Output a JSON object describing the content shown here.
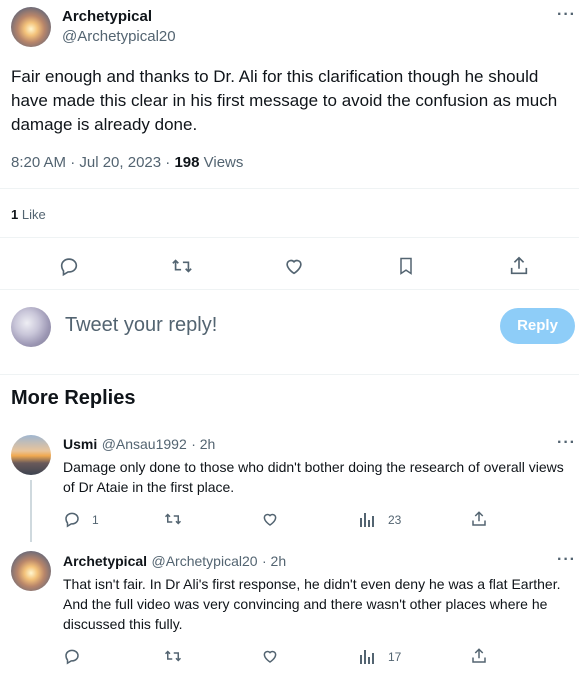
{
  "tweet": {
    "author_name": "Archetypical",
    "author_handle": "@Archetypical20",
    "more": "···",
    "text": "Fair enough and thanks to Dr. Ali for this clarification though he should have made this clear in his first message to avoid the confusion as much damage is already done.",
    "time": "8:20 AM · Jul 20, 2023 · ",
    "views_count": "198",
    "views_label": " Views",
    "likes_count": "1",
    "likes_label": " Like"
  },
  "compose": {
    "placeholder": "Tweet your reply!",
    "reply_label": "Reply"
  },
  "more_replies_title": "More Replies",
  "replies": [
    {
      "name": "Usmi",
      "handle": "@Ansau1992",
      "time": "· 2h",
      "more": "···",
      "text": "Damage only done to those who didn't bother doing the research of  overall views of Dr Ataie in the first place.",
      "reply_count": "1",
      "views_count": "23"
    },
    {
      "name": "Archetypical",
      "handle": "@Archetypical20",
      "time": "· 2h",
      "more": "···",
      "text": "That isn't fair. In Dr Ali's first response, he didn't even deny he was a flat Earther. And the full video was very convincing and there wasn't other places where he discussed this fully.",
      "reply_count": "",
      "views_count": "17"
    }
  ]
}
